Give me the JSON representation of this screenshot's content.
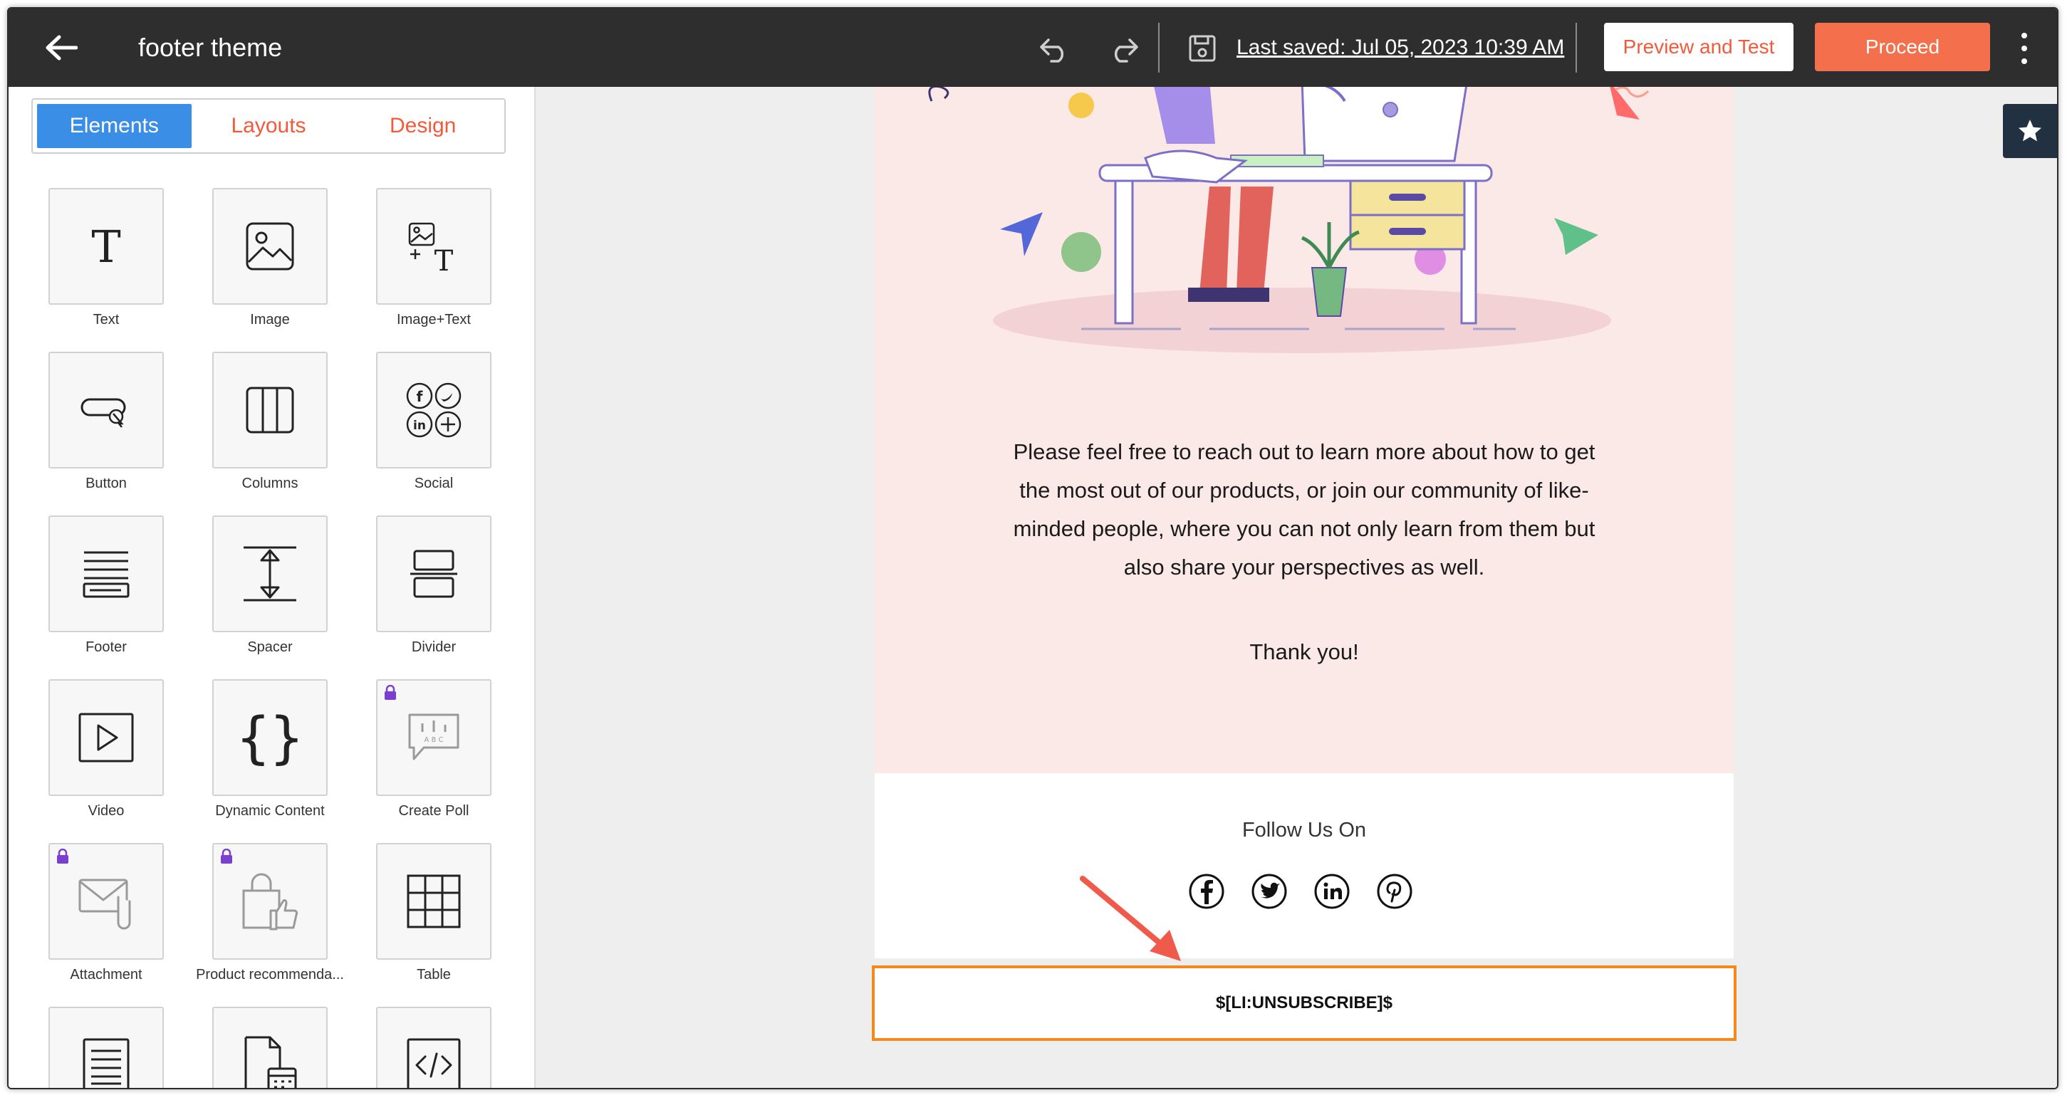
{
  "header": {
    "title": "footer theme",
    "last_saved": "Last saved: Jul 05, 2023 10:39 AM",
    "preview_label": "Preview and Test",
    "proceed_label": "Proceed",
    "icons": [
      "back-arrow-icon",
      "undo-icon",
      "redo-icon",
      "save-icon",
      "more-vertical-icon"
    ]
  },
  "sidebar": {
    "tabs": [
      {
        "label": "Elements",
        "active": true
      },
      {
        "label": "Layouts",
        "active": false
      },
      {
        "label": "Design",
        "active": false
      }
    ],
    "elements": [
      {
        "label": "Text",
        "icon": "text-icon",
        "locked": false
      },
      {
        "label": "Image",
        "icon": "image-icon",
        "locked": false
      },
      {
        "label": "Image+Text",
        "icon": "image-text-icon",
        "locked": false
      },
      {
        "label": "Button",
        "icon": "button-icon",
        "locked": false
      },
      {
        "label": "Columns",
        "icon": "columns-icon",
        "locked": false
      },
      {
        "label": "Social",
        "icon": "social-icon",
        "locked": false
      },
      {
        "label": "Footer",
        "icon": "footer-icon",
        "locked": false
      },
      {
        "label": "Spacer",
        "icon": "spacer-icon",
        "locked": false
      },
      {
        "label": "Divider",
        "icon": "divider-icon",
        "locked": false
      },
      {
        "label": "Video",
        "icon": "video-icon",
        "locked": false
      },
      {
        "label": "Dynamic Content",
        "icon": "braces-icon",
        "locked": false
      },
      {
        "label": "Create Poll",
        "icon": "poll-icon",
        "locked": true
      },
      {
        "label": "Attachment",
        "icon": "attachment-icon",
        "locked": true
      },
      {
        "label": "Product recommenda...",
        "icon": "product-recommendation-icon",
        "locked": true
      },
      {
        "label": "Table",
        "icon": "table-icon",
        "locked": false
      },
      {
        "label": "",
        "icon": "document-icon",
        "locked": false
      },
      {
        "label": "",
        "icon": "calendar-file-icon",
        "locked": false
      },
      {
        "label": "",
        "icon": "code-icon",
        "locked": false
      }
    ]
  },
  "email": {
    "body_text": "Please feel free to reach out to learn more about how to get the most out of our products, or join our community of like-minded people, where you can not only learn from them but also share your perspectives as well.",
    "thanks": "Thank you!",
    "follow_label": "Follow Us On",
    "social_icons": [
      "facebook-icon",
      "twitter-icon",
      "linkedin-icon",
      "pinterest-icon"
    ],
    "unsubscribe": "$[LI:UNSUBSCRIBE]$"
  },
  "colors": {
    "topbar": "#2e2e2e",
    "accent_orange": "#f4704c",
    "tab_active": "#3a8ee6",
    "email_bg": "#fbe9e7",
    "highlight": "#f28a1e",
    "callout_arrow": "#ef5a4a"
  }
}
